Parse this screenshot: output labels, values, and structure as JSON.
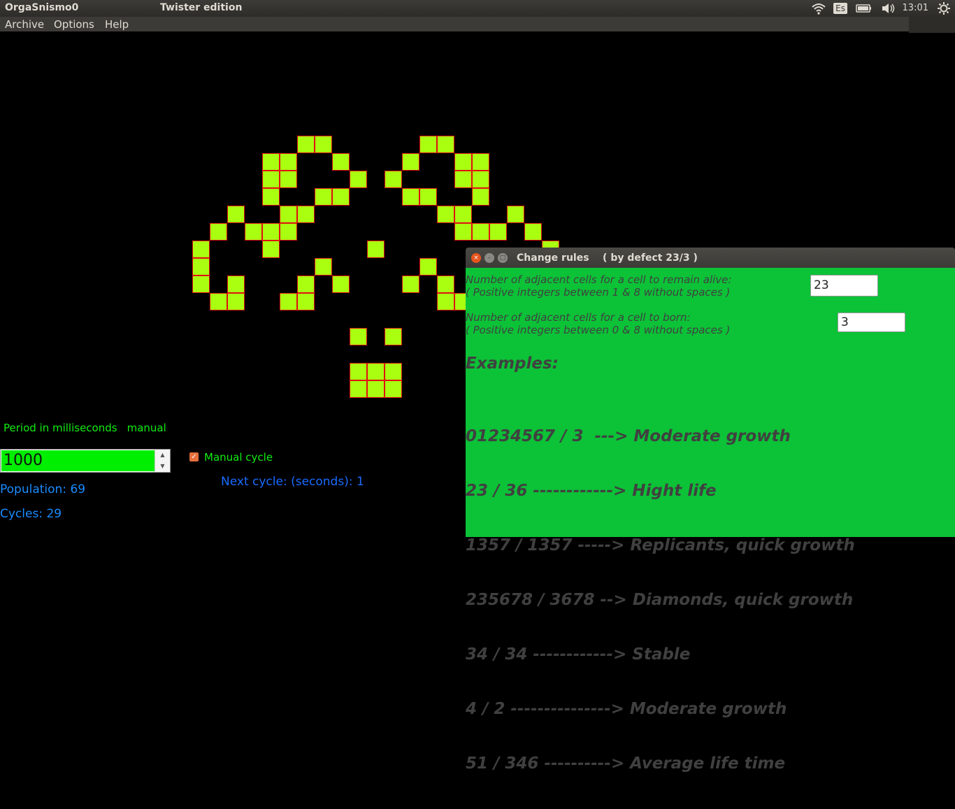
{
  "top_panel": {
    "app_title": "OrgaSnismo0",
    "window_title": "Twister edition",
    "keyboard_layout": "Es",
    "clock": "13:01",
    "icons": [
      "wifi-icon",
      "keyboard-layout-icon",
      "battery-icon",
      "volume-icon",
      "settings-gear-icon"
    ]
  },
  "menu": {
    "items": [
      "Archive",
      "Options",
      "Help"
    ]
  },
  "controls": {
    "period_label": "Period in milliseconds",
    "period_mode": "manual",
    "period_value": "1000",
    "manual_cycle_label": "Manual cycle",
    "manual_cycle_checked": true,
    "next_cycle": "Next cycle: (seconds): 1",
    "population": "Population: 69",
    "cycles": "Cycles: 29"
  },
  "board": {
    "cell_color": "#aaff11",
    "border_color": "#e01010",
    "live_cells": [
      [
        17,
        7
      ],
      [
        18,
        7
      ],
      [
        24,
        7
      ],
      [
        25,
        7
      ],
      [
        15,
        8
      ],
      [
        16,
        8
      ],
      [
        19,
        8
      ],
      [
        23,
        8
      ],
      [
        26,
        8
      ],
      [
        27,
        8
      ],
      [
        15,
        9
      ],
      [
        16,
        9
      ],
      [
        20,
        9
      ],
      [
        22,
        9
      ],
      [
        26,
        9
      ],
      [
        27,
        9
      ],
      [
        15,
        10
      ],
      [
        18,
        10
      ],
      [
        19,
        10
      ],
      [
        23,
        10
      ],
      [
        24,
        10
      ],
      [
        27,
        10
      ],
      [
        13,
        11
      ],
      [
        16,
        11
      ],
      [
        17,
        11
      ],
      [
        25,
        11
      ],
      [
        26,
        11
      ],
      [
        29,
        11
      ],
      [
        12,
        12
      ],
      [
        14,
        12
      ],
      [
        15,
        12
      ],
      [
        16,
        12
      ],
      [
        26,
        12
      ],
      [
        27,
        12
      ],
      [
        28,
        12
      ],
      [
        30,
        12
      ],
      [
        11,
        13
      ],
      [
        15,
        13
      ],
      [
        21,
        13
      ],
      [
        31,
        13
      ],
      [
        11,
        14
      ],
      [
        18,
        14
      ],
      [
        24,
        14
      ],
      [
        11,
        15
      ],
      [
        13,
        15
      ],
      [
        17,
        15
      ],
      [
        19,
        15
      ],
      [
        23,
        15
      ],
      [
        25,
        15
      ],
      [
        12,
        16
      ],
      [
        13,
        16
      ],
      [
        16,
        16
      ],
      [
        17,
        16
      ],
      [
        25,
        16
      ],
      [
        26,
        16
      ],
      [
        20,
        18
      ],
      [
        22,
        18
      ],
      [
        20,
        20
      ],
      [
        21,
        20
      ],
      [
        22,
        20
      ],
      [
        20,
        21
      ],
      [
        21,
        21
      ],
      [
        22,
        21
      ]
    ]
  },
  "dialog": {
    "title": "Change rules    ( by defect 23/3 )",
    "survive_label_line1": "Number of adjacent cells for a cell to remain alive:",
    "survive_label_line2": "( Positive integers between 1 & 8 without spaces )",
    "survive_value": "23",
    "born_label_line1": "Number of adjacent cells for a cell to born:",
    "born_label_line2": "( Positive integers between 0 & 8 without spaces )",
    "born_value": "3",
    "examples_title": "Examples:",
    "examples": [
      "01234567 / 3  ---> Moderate growth",
      "23 / 36 ------------> Hight life",
      "1357 / 1357 -----> Replicants, quick growth",
      "235678 / 3678 --> Diamonds, quick growth",
      "34 / 34 ------------> Stable",
      "4 / 2 ---------------> Moderate growth",
      "51 / 346 ----------> Average life time"
    ]
  }
}
